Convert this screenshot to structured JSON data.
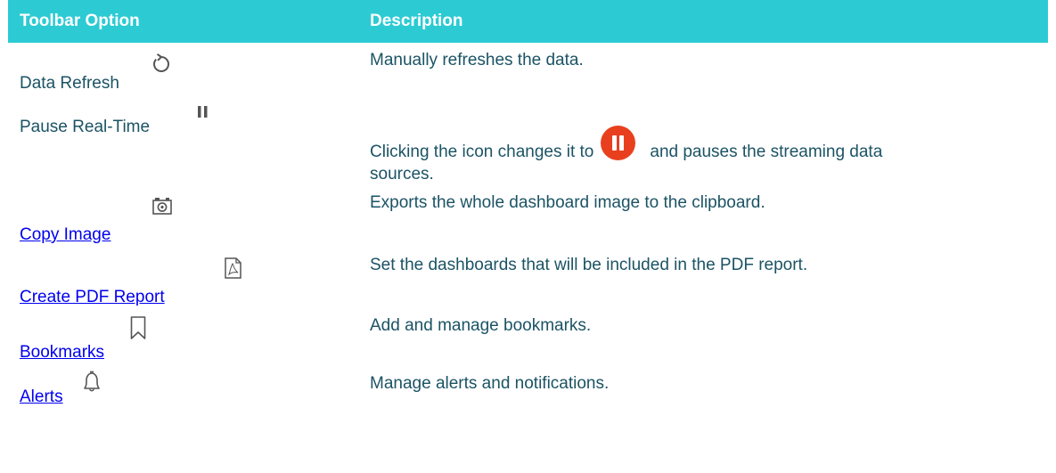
{
  "table": {
    "headers": [
      "Toolbar Option",
      "Description"
    ],
    "rows": [
      {
        "option": "Data Refresh",
        "is_link": false,
        "icon": "refresh-icon",
        "description": "Manually refreshes the data."
      },
      {
        "option": "Pause Real-Time",
        "is_link": false,
        "icon": "pause-icon",
        "description_before": "Clicking the icon changes it to",
        "description_after": "and pauses the streaming data",
        "description_line2": "sources."
      },
      {
        "option": "Copy Image",
        "is_link": true,
        "icon": "camera-icon",
        "description": "Exports the whole dashboard image to the clipboard."
      },
      {
        "option": "Create PDF Report",
        "is_link": true,
        "icon": "pdf-icon",
        "description": "Set the dashboards that will be included in the PDF report."
      },
      {
        "option": "Bookmarks",
        "is_link": true,
        "icon": "bookmark-icon",
        "description": "Add and manage bookmarks."
      },
      {
        "option": "Alerts",
        "is_link": true,
        "icon": "bell-icon",
        "description": "Manage alerts and notifications."
      }
    ]
  },
  "colors": {
    "header_bg": "#2ccbd4",
    "header_text": "#ffffff",
    "body_text": "#1b5364",
    "link": "#0000ee",
    "pause_active": "#e8401e"
  }
}
